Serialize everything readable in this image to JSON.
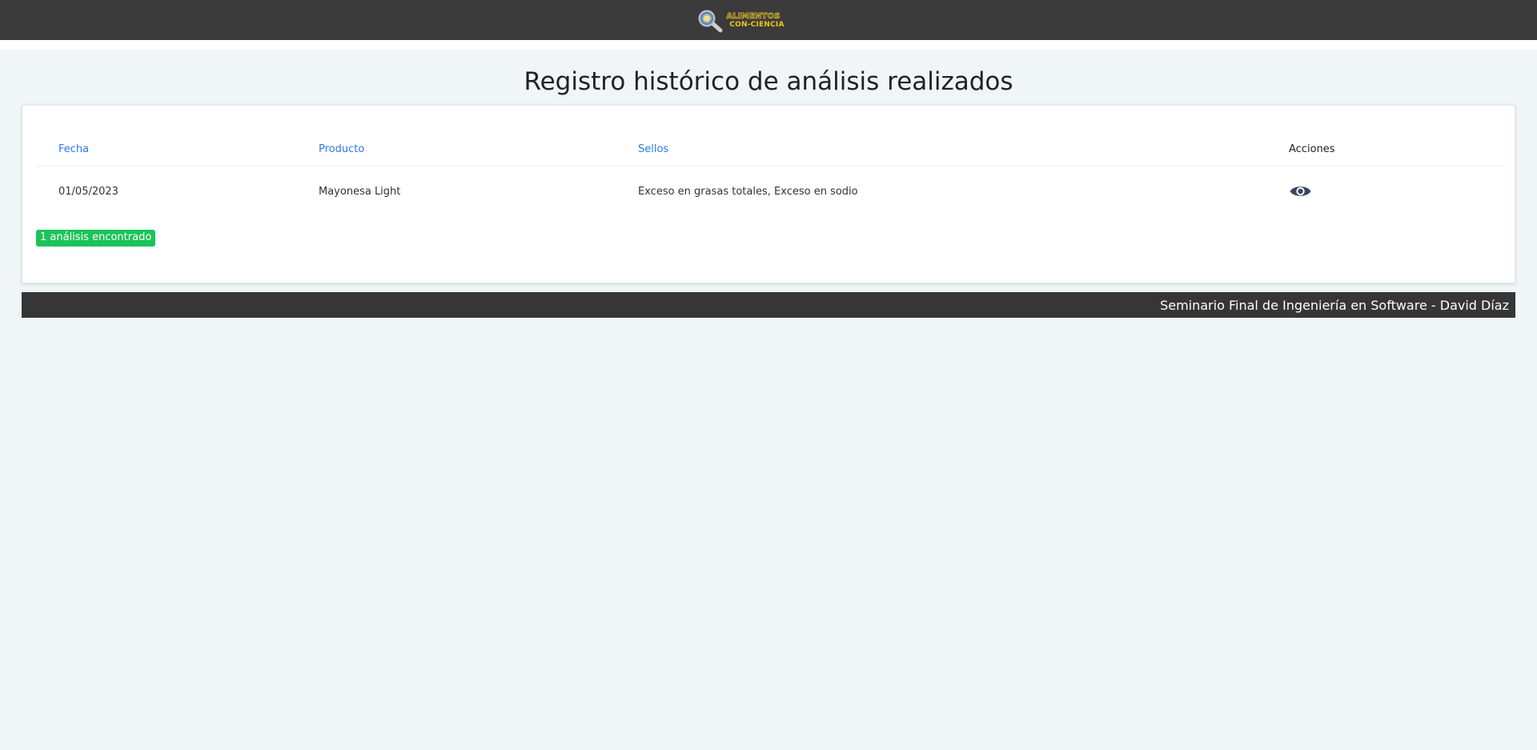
{
  "header": {
    "logo": {
      "line1": "ALIMENTOS",
      "line2": "CON-CIENCIA",
      "icon": "magnifier-icon"
    }
  },
  "page": {
    "title": "Registro histórico de análisis realizados"
  },
  "table": {
    "headers": [
      "Fecha",
      "Producto",
      "Sellos",
      "Acciones"
    ],
    "rows": [
      {
        "fecha": "01/05/2023",
        "producto": "Mayonesa Light",
        "sellos": "Exceso en grasas totales, Exceso en sodio",
        "action_icon": "eye-icon"
      }
    ]
  },
  "status": {
    "badge": "1 análisis encontrado"
  },
  "footer": {
    "text": "Seminario Final de Ingeniería en Software - David Díaz"
  },
  "colors": {
    "topbar": "#3b3b3b",
    "background": "#f0f5f7",
    "header_link": "#2c7be5",
    "badge": "#1bc45a",
    "footer": "#363636",
    "eye_icon": "#374760"
  }
}
